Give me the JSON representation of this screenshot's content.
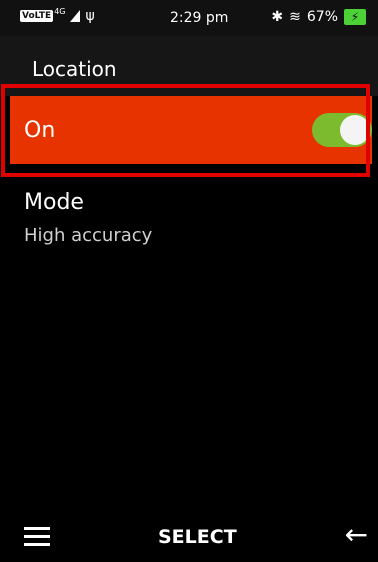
{
  "status_bar": {
    "network_badge": "VoLTE",
    "network_type": "4G",
    "time": "2:29 pm",
    "battery": "67%",
    "icons": [
      "signal-icon",
      "usb-icon",
      "bluetooth-icon",
      "vibrate-icon",
      "battery-charging-icon"
    ]
  },
  "header": {
    "title": "Location"
  },
  "location_toggle": {
    "label": "On",
    "checked": true,
    "accent_color": "#e73300",
    "switch_color": "#7dbb2e"
  },
  "mode": {
    "title": "Mode",
    "value": "High accuracy"
  },
  "softkeys": {
    "left_icon": "menu-icon",
    "center_label": "SELECT",
    "right_icon": "back-arrow-icon"
  }
}
